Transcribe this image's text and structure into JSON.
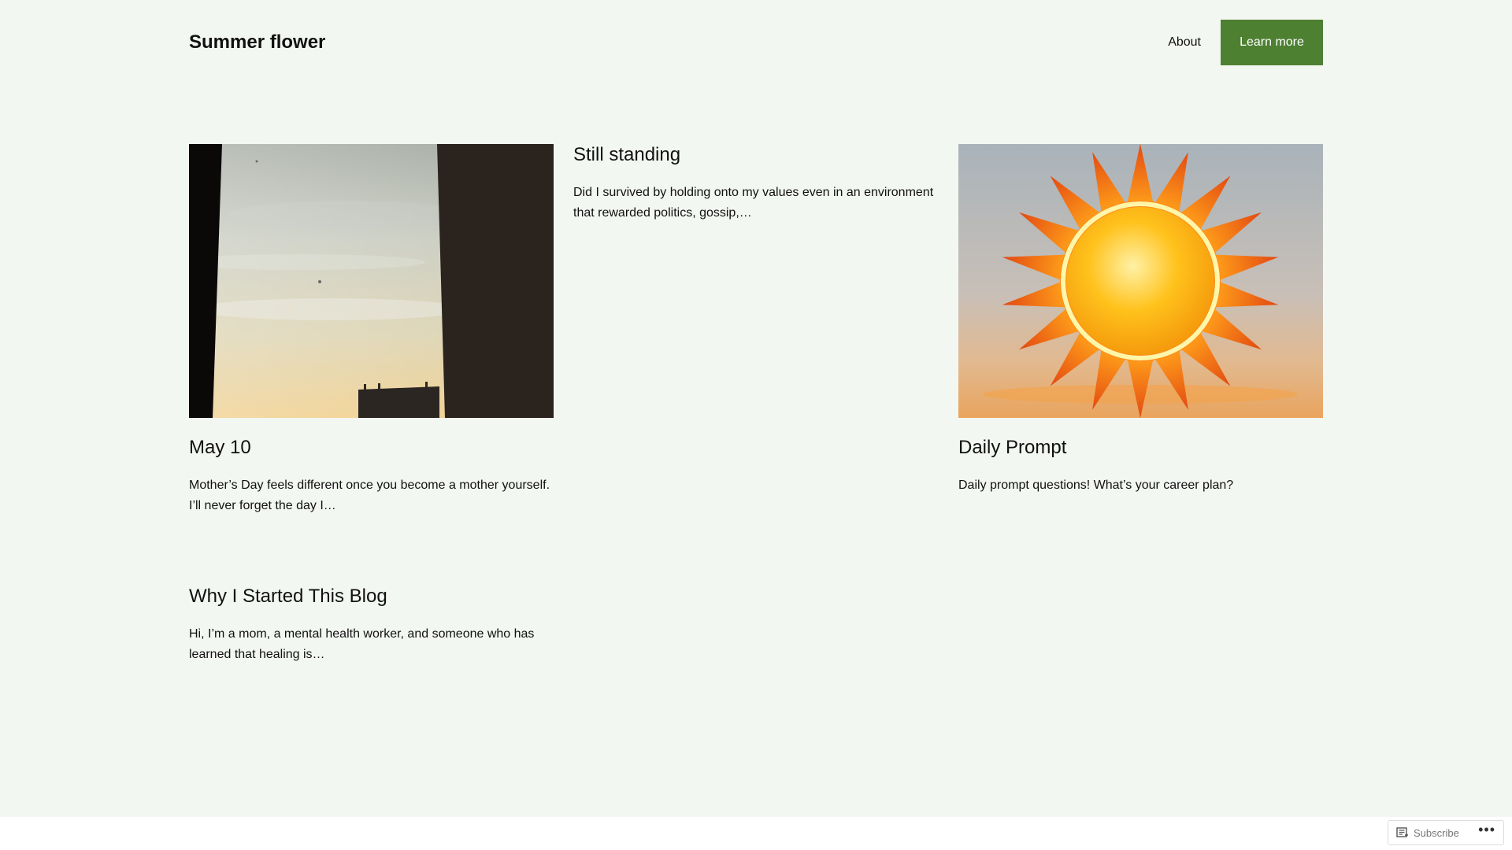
{
  "header": {
    "site_title": "Summer flower",
    "nav": {
      "about": "About",
      "learn_more": "Learn more"
    }
  },
  "posts": [
    {
      "title": "May 10",
      "excerpt": "Mother’s Day feels different once you become a mother yourself. I’ll never forget the day I…",
      "image": "sky-window-photo"
    },
    {
      "title": "Still standing",
      "excerpt": "Did I survived by holding onto my values even in an environment that rewarded politics, gossip,…"
    },
    {
      "title": "Daily Prompt",
      "excerpt": "Daily prompt questions! What’s your career plan?",
      "image": "sun-illustration"
    },
    {
      "title": "Why I Started This Blog",
      "excerpt": "Hi, I’m a mom, a mental health worker, and someone who has learned that healing is…"
    }
  ],
  "subscribe_bar": {
    "subscribe_label": "Subscribe",
    "more_label": "•••"
  },
  "colors": {
    "background": "#f3f7f1",
    "accent": "#4e8032",
    "text": "#111111"
  }
}
